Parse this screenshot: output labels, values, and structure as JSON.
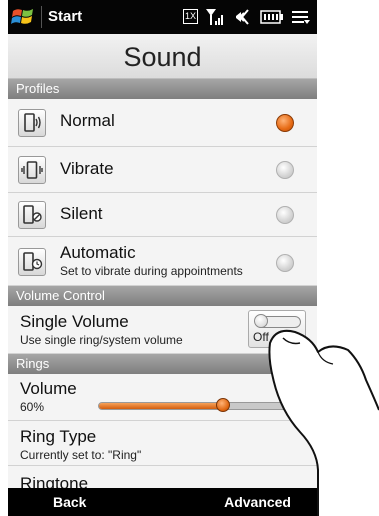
{
  "status_bar": {
    "start_label": "Start",
    "network_badge": "1X",
    "icons": [
      "windows-logo",
      "signal-icon",
      "speaker-icon",
      "battery-icon",
      "menu-lines-icon"
    ]
  },
  "page": {
    "title": "Sound"
  },
  "profiles": {
    "header": "Profiles",
    "items": [
      {
        "label": "Normal",
        "sub": "",
        "selected": true,
        "icon": "speaker-phone-icon"
      },
      {
        "label": "Vibrate",
        "sub": "",
        "selected": false,
        "icon": "vibrate-phone-icon"
      },
      {
        "label": "Silent",
        "sub": "",
        "selected": false,
        "icon": "silent-phone-icon"
      },
      {
        "label": "Automatic",
        "sub": "Set to vibrate during appointments",
        "selected": false,
        "icon": "clock-phone-icon"
      }
    ]
  },
  "volume_control": {
    "header": "Volume Control",
    "single_volume_label": "Single Volume",
    "single_volume_sub": "Use single ring/system volume",
    "toggle_text": "Off"
  },
  "rings": {
    "header": "Rings",
    "volume_label": "Volume",
    "volume_value": "60%",
    "volume_level": 0.6,
    "ring_type_label": "Ring Type",
    "ring_type_sub": "Currently set to: \"Ring\"",
    "ringtone_label": "Ringtone"
  },
  "bottom_bar": {
    "left": "Back",
    "right": "Advanced"
  },
  "colors": {
    "accent": "#e66a14",
    "section": "#8c8c8c",
    "bar": "#000000"
  }
}
